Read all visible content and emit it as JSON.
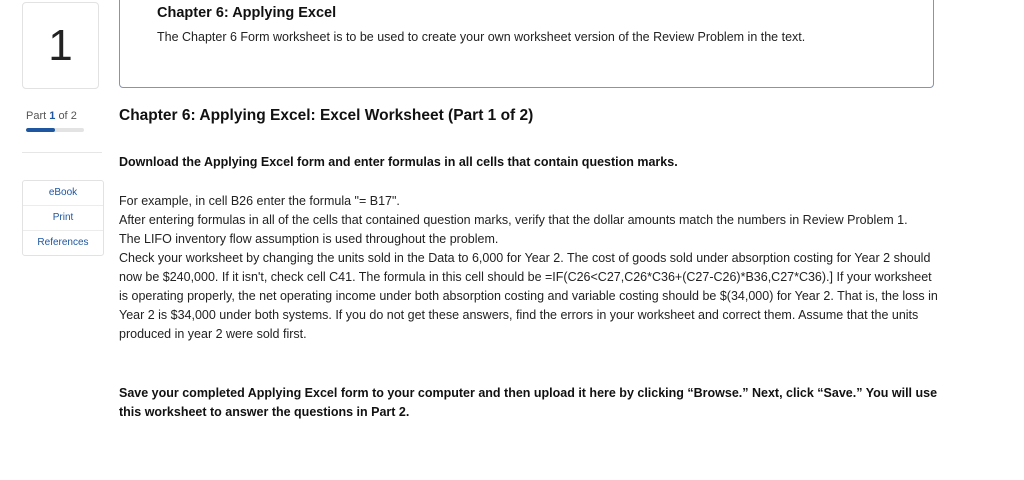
{
  "question": {
    "number": "1"
  },
  "intro": {
    "title": "Chapter 6: Applying Excel",
    "text": "The Chapter 6 Form worksheet is to be used to create your own worksheet version of the Review Problem in the text."
  },
  "progress": {
    "part_word": "Part",
    "current": "1",
    "of_word": "of",
    "total": "2",
    "fraction": 0.5
  },
  "resources": [
    "eBook",
    "Print",
    "References"
  ],
  "main": {
    "part_title": "Chapter 6: Applying Excel: Excel Worksheet (Part 1 of 2)",
    "download_instruction": "Download the Applying Excel form and enter formulas in all cells that contain question marks.",
    "paragraphs": [
      "For example, in cell B26 enter the formula \"= B17\".",
      "After entering formulas in all of the cells that contained question marks, verify that the dollar amounts match the numbers in Review Problem 1.",
      "The LIFO inventory flow assumption is used throughout the problem.",
      "Check your worksheet by changing the units sold in the Data to 6,000 for Year 2. The cost of goods sold under absorption costing for Year 2 should now be $240,000. If it isn't, check cell C41. The formula in this cell should be =IF(C26<C27,C26*C36+(C27-C26)*B36,C27*C36).] If your worksheet is operating properly, the net operating income under both absorption costing and variable costing should be $(34,000) for Year 2. That is, the loss in Year 2 is $34,000 under both systems. If you do not get these answers, find the errors in your worksheet and correct them. Assume that the units produced in year 2 were sold first."
    ],
    "save_instruction": "Save your completed Applying Excel form to your computer and then upload it here by clicking “Browse.” Next, click “Save.” You will use this worksheet to answer the questions in Part 2."
  }
}
